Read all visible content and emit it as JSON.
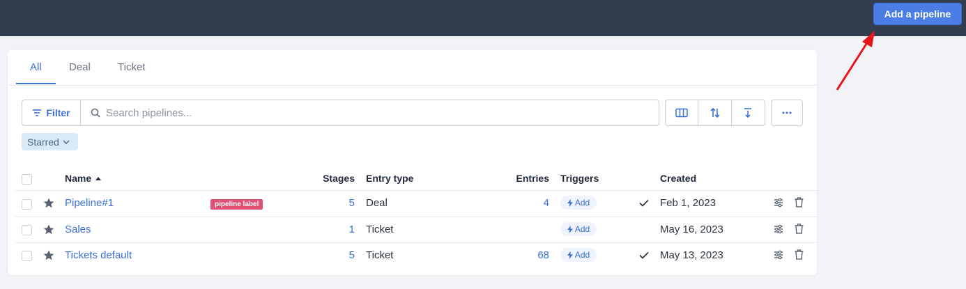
{
  "header": {
    "add_pipeline_label": "Add a pipeline"
  },
  "tabs": [
    {
      "label": "All"
    },
    {
      "label": "Deal"
    },
    {
      "label": "Ticket"
    }
  ],
  "toolbar": {
    "filter_label": "Filter",
    "search_placeholder": "Search pipelines...",
    "starred_label": "Starred"
  },
  "table": {
    "columns": {
      "name": "Name",
      "stages": "Stages",
      "entry_type": "Entry type",
      "entries": "Entries",
      "triggers": "Triggers",
      "created": "Created"
    },
    "rows": [
      {
        "name": "Pipeline#1",
        "label": "pipeline label",
        "stages": "5",
        "entry_type": "Deal",
        "entries": "4",
        "trigger": "Add",
        "checked": true,
        "created": "Feb 1, 2023"
      },
      {
        "name": "Sales",
        "label": "",
        "stages": "1",
        "entry_type": "Ticket",
        "entries": "",
        "trigger": "Add",
        "checked": false,
        "created": "May 16, 2023"
      },
      {
        "name": "Tickets default",
        "label": "",
        "stages": "5",
        "entry_type": "Ticket",
        "entries": "68",
        "trigger": "Add",
        "checked": true,
        "created": "May 13, 2023"
      }
    ]
  },
  "colors": {
    "accent": "#3b6fd6",
    "topbar": "#323d4f",
    "badge": "#e05075",
    "arrow": "#e8141a"
  }
}
